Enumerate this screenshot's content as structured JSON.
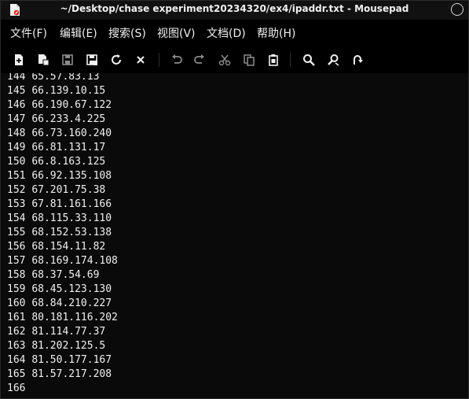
{
  "window": {
    "title": "~/Desktop/chase experiment20234320/ex4/ipaddr.txt - Mousepad"
  },
  "menu": [
    {
      "label": "文件(F)"
    },
    {
      "label": "编辑(E)"
    },
    {
      "label": "搜索(S)"
    },
    {
      "label": "视图(V)"
    },
    {
      "label": "文档(D)"
    },
    {
      "label": "帮助(H)"
    }
  ],
  "toolbar": [
    {
      "icon": "new-document-icon"
    },
    {
      "icon": "new-window-icon"
    },
    {
      "icon": "save-icon"
    },
    {
      "icon": "save-as-icon"
    },
    {
      "icon": "reload-icon"
    },
    {
      "icon": "close-icon"
    },
    {
      "icon": "undo-icon"
    },
    {
      "icon": "redo-icon"
    },
    {
      "icon": "cut-icon"
    },
    {
      "icon": "copy-icon"
    },
    {
      "icon": "paste-icon"
    },
    {
      "icon": "find-icon"
    },
    {
      "icon": "find-replace-icon"
    },
    {
      "icon": "go-to-line-icon"
    }
  ],
  "editor": {
    "lines": [
      {
        "num": "144",
        "text": "65.57.83.13"
      },
      {
        "num": "145",
        "text": "66.139.10.15"
      },
      {
        "num": "146",
        "text": "66.190.67.122"
      },
      {
        "num": "147",
        "text": "66.233.4.225"
      },
      {
        "num": "148",
        "text": "66.73.160.240"
      },
      {
        "num": "149",
        "text": "66.81.131.17"
      },
      {
        "num": "150",
        "text": "66.8.163.125"
      },
      {
        "num": "151",
        "text": "66.92.135.108"
      },
      {
        "num": "152",
        "text": "67.201.75.38"
      },
      {
        "num": "153",
        "text": "67.81.161.166"
      },
      {
        "num": "154",
        "text": "68.115.33.110"
      },
      {
        "num": "155",
        "text": "68.152.53.138"
      },
      {
        "num": "156",
        "text": "68.154.11.82"
      },
      {
        "num": "157",
        "text": "68.169.174.108"
      },
      {
        "num": "158",
        "text": "68.37.54.69"
      },
      {
        "num": "159",
        "text": "68.45.123.130"
      },
      {
        "num": "160",
        "text": "68.84.210.227"
      },
      {
        "num": "161",
        "text": "80.181.116.202"
      },
      {
        "num": "162",
        "text": "81.114.77.37"
      },
      {
        "num": "163",
        "text": "81.202.125.5"
      },
      {
        "num": "164",
        "text": "81.50.177.167"
      },
      {
        "num": "165",
        "text": "81.57.217.208"
      },
      {
        "num": "166",
        "text": ""
      }
    ]
  }
}
